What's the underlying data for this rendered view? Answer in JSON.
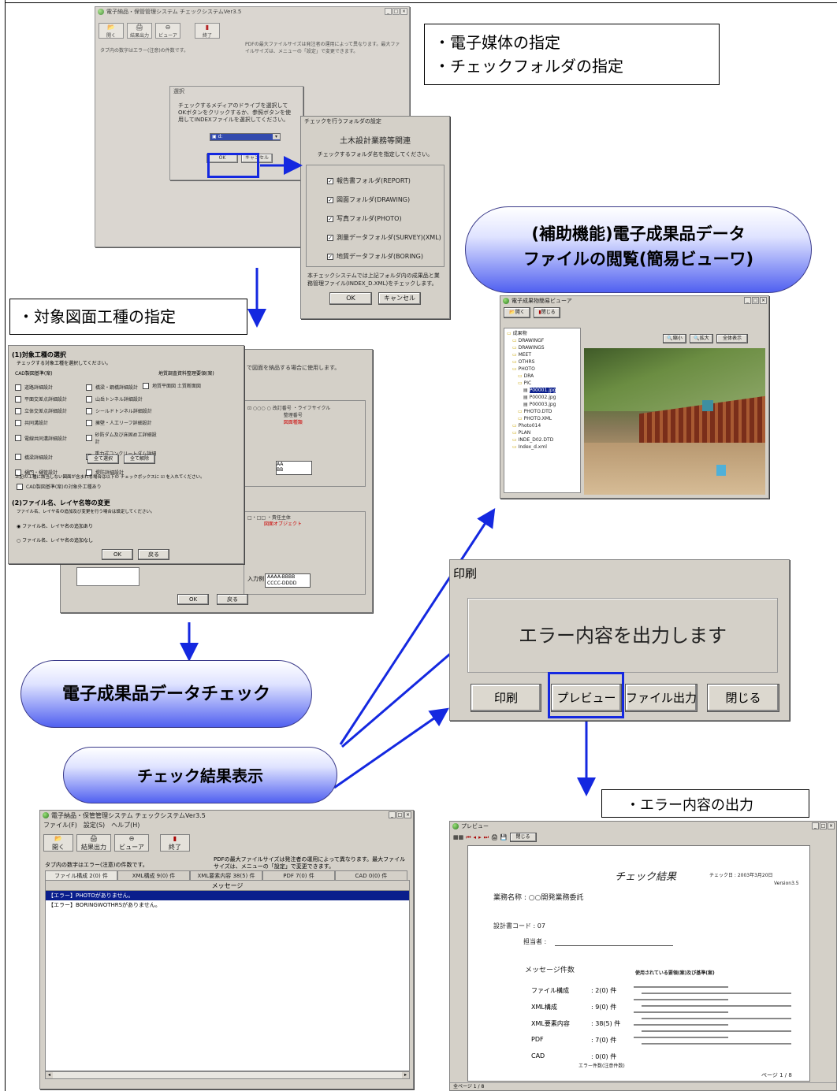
{
  "callouts": {
    "media_line1": "・電子媒体の指定",
    "media_line2": "・チェックフォルダの指定",
    "target_type": "・対象図面工種の指定",
    "error_output": "・エラー内容の出力"
  },
  "pills": {
    "viewer_line1": "(補助機能)電子成果品データ",
    "viewer_line2": "ファイルの閲覧(簡易ビューワ)",
    "data_check": "電子成果品データチェック",
    "result_display": "チェック結果表示"
  },
  "main_window": {
    "title": "電子納品・保管管理システム チェックシステムVer3.5",
    "menu": [
      "ファイル(F)",
      "設定(S)",
      "ヘルプ(H)"
    ],
    "toolbar": [
      "開く",
      "結果出力",
      "ビューア",
      "終了"
    ],
    "info_text": "PDFの最大ファイルサイズは発注者の運用によって異なります。最大ファイルサイズは、メニューの「設定」で変更できます。",
    "tab_hint": "タブ内の数字はエラー(注意)の件数です。",
    "tabs": [
      "ファイル構成 2(0) 件",
      "XML構成 9(0) 件",
      "XML要素内容 38(5) 件",
      "PDF 7(0) 件",
      "CAD 0(0) 件"
    ],
    "list_header": "メッセージ",
    "messages": [
      "【エラー】PHOTOがありません。",
      "【エラー】BORINGWOTHRSがありません。"
    ]
  },
  "select_dialog": {
    "title": "選択",
    "text": "チェックするメディアのドライブを選択してOKボタンをクリックするか、参照ボタンを使用してINDEXファイルを選択してください。",
    "ok": "OK",
    "cancel": "キャンセル"
  },
  "folder_dialog": {
    "title": "チェックを行うフォルダの設定",
    "heading": "土木設計業務等関連",
    "subheading": "チェックするフォルダ名を指定してください。",
    "folders": [
      "報告書フォルダ(REPORT)",
      "図面フォルダ(DRAWING)",
      "写真フォルダ(PHOTO)",
      "測量データフォルダ(SURVEY)(XML)",
      "地質データフォルダ(BORING)"
    ],
    "note": "本チェックシステムでは上記フォルダ内の成果品と業務管理ファイル(INDEX_D.XML)をチェックします。",
    "ok": "OK",
    "cancel": "キャンセル"
  },
  "work_dialog": {
    "section1": "(1)対象工種の選択",
    "section1_hint": "チェックする対象工種を選択してください。",
    "col1_title": "CAD製図基準(案)",
    "col2_title": "地質調査資料整理要領(案)",
    "col2_item": "地質平面図 土質断面図",
    "work_items": [
      "道路詳細設計",
      "橋梁・鋼橋詳細設計",
      "平面交差点詳細設計",
      "山岳トンネル詳細設計",
      "立体交差点詳細設計",
      "シールドトンネル詳細設計",
      "共同溝設計",
      "擁壁・人工リーフ詳細設計",
      "電線共同溝詳細設計",
      "砂防ダム及び床固め工詳細設計",
      "橋梁詳細設計",
      "重力式コンクリートダム詳細設計",
      "樋門・樋管設計",
      "堤防詳細設計"
    ],
    "select_all": "全て選択",
    "clear_all": "全て解除",
    "other_hint": "上記の工種に該当しない図面が含まれる場合は以下の チェックボックスに ☑ を入れてください。",
    "other_item": "CAD製図基準(案)の対象外工種あり",
    "section2": "(2)ファイル名、レイヤ名等の変更",
    "section2_hint": "ファイル名、レイヤ名の追加及び変更を行う場合は設定してください。",
    "radio1": "ファイル名、レイヤ名の追加あり",
    "radio2": "ファイル名、レイヤ名の追加なし",
    "ok": "OK",
    "back": "戻る",
    "back_text": "で図面を納品する場合に使用します。",
    "input_example_label": "入力例",
    "input_example_1": "AAAA-BBBB",
    "input_example_2": "CCCC-DDDD",
    "back_ok": "OK",
    "back_back": "戻る"
  },
  "viewer": {
    "title": "電子成果物簡易ビューア",
    "open": "開く",
    "close": "閉じる",
    "zoom_out": "縮小",
    "zoom_in": "拡大",
    "fit": "全体表示",
    "tree": [
      "成果物",
      "DRAWINGF",
      "DRAWINGS",
      "MEET",
      "OTHRS",
      "PHOTO",
      "DRA",
      "PIC",
      "P00001.jpg",
      "P00002.jpg",
      "P00003.jpg",
      "PHOTO.DTD",
      "PHOTO.XML",
      "Photo014",
      "PLAN",
      "INDE_D02.DTD",
      "Index_d.xml"
    ]
  },
  "print_dialog": {
    "title": "印刷",
    "message": "エラー内容を出力します",
    "print": "印刷",
    "preview": "プレビュー",
    "file_output": "ファイル出力",
    "close": "閉じる"
  },
  "preview": {
    "title": "プレビュー",
    "close_btn": "閉じる",
    "report_title": "チェック結果",
    "check_date": "チェック日 : 2003年3月20日",
    "version": "Version3.5",
    "project_name": "業務名称 : ○○開発業務委託",
    "design_code": "設計書コード : 07",
    "person": "担当者 :",
    "count_heading": "メッセージ件数",
    "standards_heading": "使用されている要領(案)及び基準(案)",
    "counts": [
      {
        "label": "ファイル構成",
        "value": ": 2(0) 件"
      },
      {
        "label": "XML構成",
        "value": ": 9(0) 件"
      },
      {
        "label": "XML要素内容",
        "value": ": 38(5) 件"
      },
      {
        "label": "PDF",
        "value": ": 7(0) 件"
      },
      {
        "label": "CAD",
        "value": ": 0(0) 件"
      }
    ],
    "error_note": "エラー件数(注意件数)",
    "page": "ページ 1 / 8",
    "status": "全ページ 1 / 8"
  }
}
